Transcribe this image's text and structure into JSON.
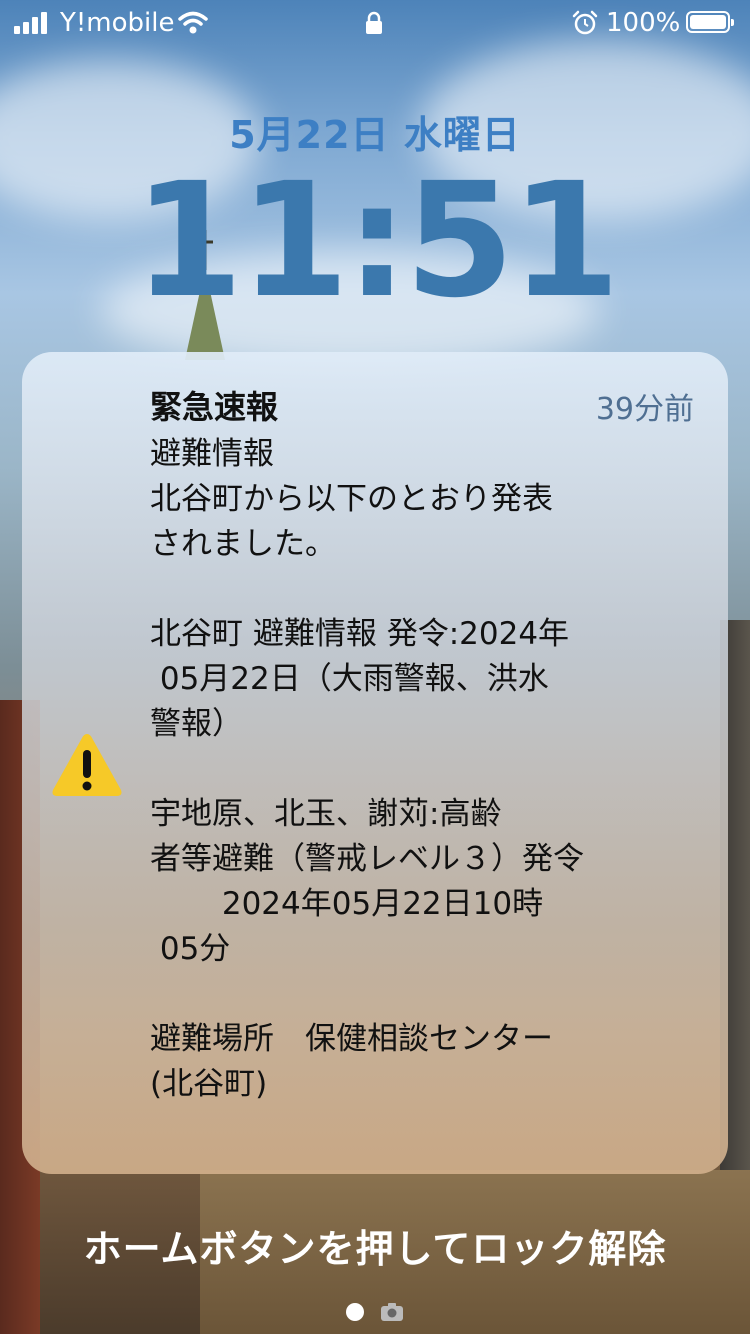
{
  "status_bar": {
    "carrier": "Y!mobile",
    "battery_percent": "100%",
    "icons": [
      "signal-icon",
      "wifi-icon",
      "lock-icon",
      "alarm-icon",
      "battery-icon"
    ]
  },
  "lock_screen": {
    "date": "5月22日 水曜日",
    "time": "11:51"
  },
  "notification": {
    "icon": "warning-icon",
    "title": "緊急速報",
    "time_ago": "39分前",
    "body_lines": [
      "避難情報",
      "北谷町から以下のとおり発表",
      "されました。",
      "",
      "北谷町 避難情報 発令:2024年",
      " 05月22日（大雨警報、洪水",
      "警報）",
      "",
      "宇地原、北玉、謝苅:高齢",
      "者等避難（警戒レベル３）発令",
      "　　 2024年05月22日10時",
      " 05分",
      "",
      "避難場所　保健相談センター",
      "(北谷町)"
    ]
  },
  "unlock_hint": "ホームボタンを押してロック解除",
  "page_indicator": {
    "icons": [
      "page-dot-icon",
      "camera-icon"
    ]
  },
  "colors": {
    "date_time": "#3b78ad",
    "time_ago": "#4f6f92",
    "warning_yellow": "#f6c928"
  }
}
